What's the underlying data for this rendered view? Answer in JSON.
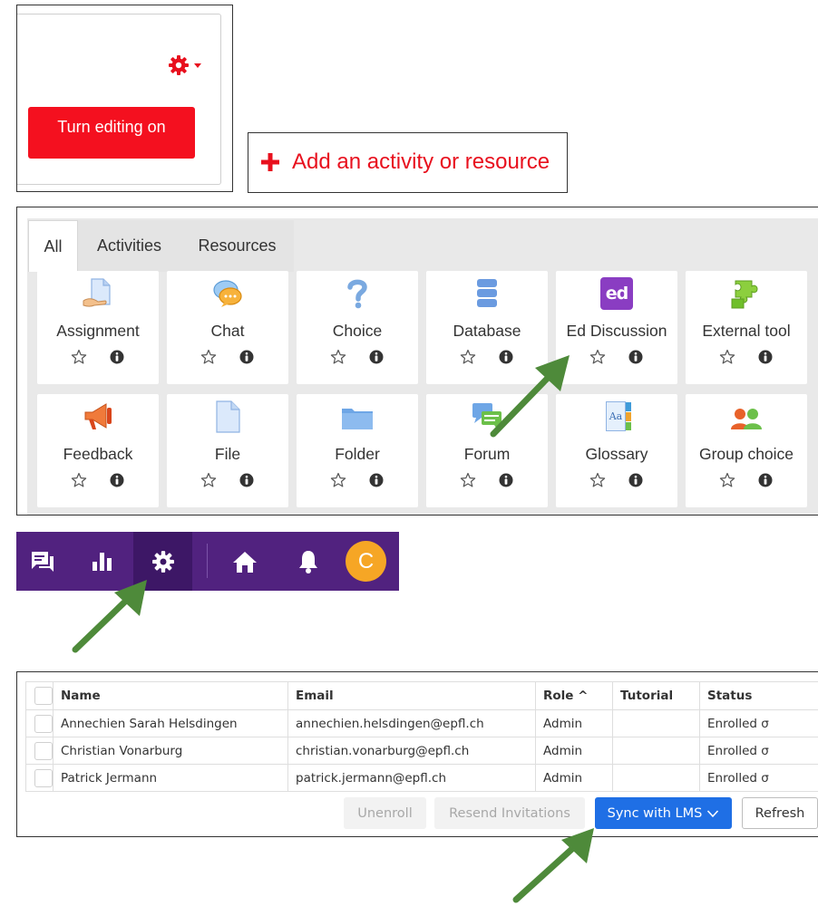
{
  "editing_panel": {
    "turn_editing_label": "Turn editing on",
    "accent_color": "#f4101f"
  },
  "add_panel": {
    "label": "Add an activity or resource",
    "accent_color": "#e8101e"
  },
  "chooser": {
    "tabs": [
      "All",
      "Activities",
      "Resources"
    ],
    "active_tab": "All",
    "items": [
      {
        "label": "Assignment",
        "icon": "assignment-icon"
      },
      {
        "label": "Chat",
        "icon": "chat-icon"
      },
      {
        "label": "Choice",
        "icon": "choice-icon"
      },
      {
        "label": "Database",
        "icon": "database-icon"
      },
      {
        "label": "Ed Discussion",
        "icon": "ed-discussion-icon",
        "icon_text": "ed"
      },
      {
        "label": "External tool",
        "icon": "external-tool-icon"
      },
      {
        "label": "Feedback",
        "icon": "feedback-icon"
      },
      {
        "label": "File",
        "icon": "file-icon"
      },
      {
        "label": "Folder",
        "icon": "folder-icon"
      },
      {
        "label": "Forum",
        "icon": "forum-icon"
      },
      {
        "label": "Glossary",
        "icon": "glossary-icon",
        "icon_text": "Aa"
      },
      {
        "label": "Group choice",
        "icon": "group-choice-icon"
      }
    ]
  },
  "toolbar": {
    "items": [
      "discussion-icon",
      "analytics-icon",
      "settings-icon",
      "home-icon",
      "notifications-icon"
    ],
    "active": "settings-icon",
    "avatar_letter": "C",
    "bg_color": "#51227f",
    "avatar_color": "#f6a625"
  },
  "roster": {
    "columns": [
      "Name",
      "Email",
      "Role ^",
      "Tutorial",
      "Status"
    ],
    "rows": [
      {
        "name": "Annechien Sarah Helsdingen",
        "email": "annechien.helsdingen@epfl.ch",
        "role": "Admin",
        "tutorial": "",
        "status": "Enrolled σ"
      },
      {
        "name": "Christian Vonarburg",
        "email": "christian.vonarburg@epfl.ch",
        "role": "Admin",
        "tutorial": "",
        "status": "Enrolled σ"
      },
      {
        "name": "Patrick Jermann",
        "email": "patrick.jermann@epfl.ch",
        "role": "Admin",
        "tutorial": "",
        "status": "Enrolled σ"
      }
    ],
    "buttons": {
      "unenroll": "Unenroll",
      "resend": "Resend Invitations",
      "sync": "Sync with LMS",
      "refresh": "Refresh"
    },
    "primary_color": "#1f6fe5"
  },
  "annotations": {
    "arrow_color": "#4e8a3a"
  }
}
